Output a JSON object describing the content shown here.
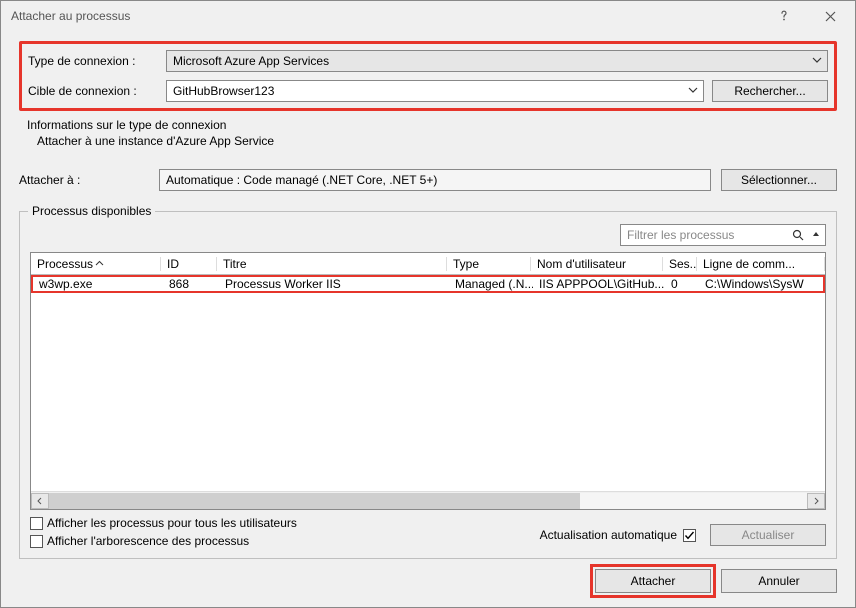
{
  "window": {
    "title": "Attacher au processus"
  },
  "conn": {
    "type_label": "Type de connexion :",
    "type_value": "Microsoft Azure App Services",
    "target_label": "Cible de connexion :",
    "target_value": "GitHubBrowser123",
    "search_btn": "Rechercher...",
    "info_heading": "Informations sur le type de connexion",
    "info_body": "Attacher à une instance d'Azure App Service"
  },
  "attach": {
    "label": "Attacher à :",
    "value": "Automatique : Code managé (.NET Core, .NET 5+)",
    "select_btn": "Sélectionner..."
  },
  "proc": {
    "legend": "Processus disponibles",
    "filter_placeholder": "Filtrer les processus",
    "cols": {
      "process": "Processus",
      "id": "ID",
      "title": "Titre",
      "type": "Type",
      "user": "Nom d'utilisateur",
      "session": "Ses...",
      "cmdline": "Ligne de comm..."
    },
    "rows": [
      {
        "process": "w3wp.exe",
        "id": "868",
        "title": "Processus Worker IIS",
        "type": "Managed (.N...",
        "user": "IIS APPPOOL\\GitHub...",
        "session": "0",
        "cmdline": "C:\\Windows\\SysW"
      }
    ],
    "show_all_users": "Afficher les processus pour tous les utilisateurs",
    "show_tree": "Afficher l'arborescence des processus",
    "auto_refresh_label": "Actualisation automatique",
    "auto_refresh_checked": true,
    "refresh_btn": "Actualiser"
  },
  "dialog": {
    "attach": "Attacher",
    "cancel": "Annuler"
  }
}
